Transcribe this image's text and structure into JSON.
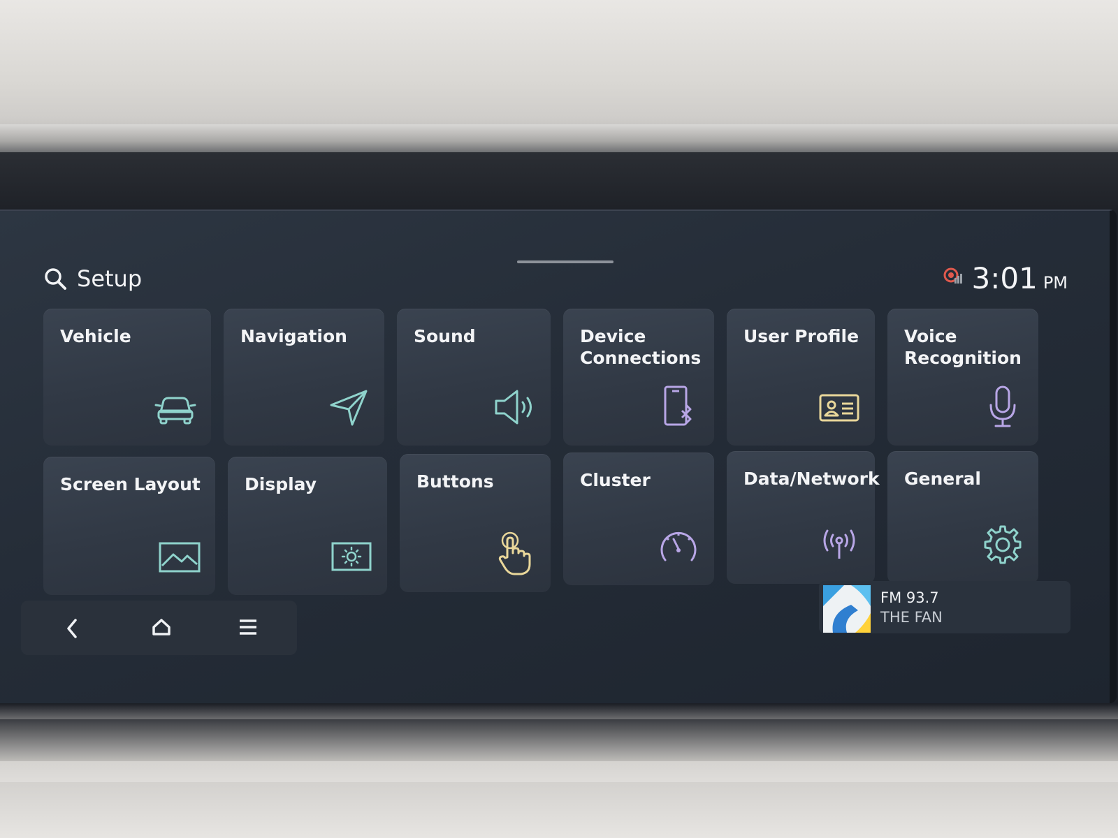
{
  "header": {
    "title": "Setup",
    "time": "3:01",
    "ampm": "PM"
  },
  "tiles": [
    {
      "label": "Vehicle",
      "icon": "car-icon"
    },
    {
      "label": "Navigation",
      "icon": "navigation-arrow-icon"
    },
    {
      "label": "Sound",
      "icon": "speaker-icon"
    },
    {
      "label": "Device Connections",
      "icon": "phone-bluetooth-icon"
    },
    {
      "label": "User Profile",
      "icon": "id-card-icon"
    },
    {
      "label": "Voice Recognition",
      "icon": "microphone-icon"
    },
    {
      "label": "Screen Layout",
      "icon": "picture-icon"
    },
    {
      "label": "Display",
      "icon": "brightness-icon"
    },
    {
      "label": "Buttons",
      "icon": "touch-hand-icon"
    },
    {
      "label": "Cluster",
      "icon": "gauge-icon"
    },
    {
      "label": "Data/Network",
      "icon": "antenna-icon"
    },
    {
      "label": "General",
      "icon": "gear-icon"
    }
  ],
  "media": {
    "frequency": "FM 93.7",
    "station": "THE FAN"
  },
  "colors": {
    "accent": "#8fd3cc",
    "icon_purple": "#b8a6e6",
    "icon_yellow": "#e9d79a",
    "screen_bg": "#262e39"
  }
}
